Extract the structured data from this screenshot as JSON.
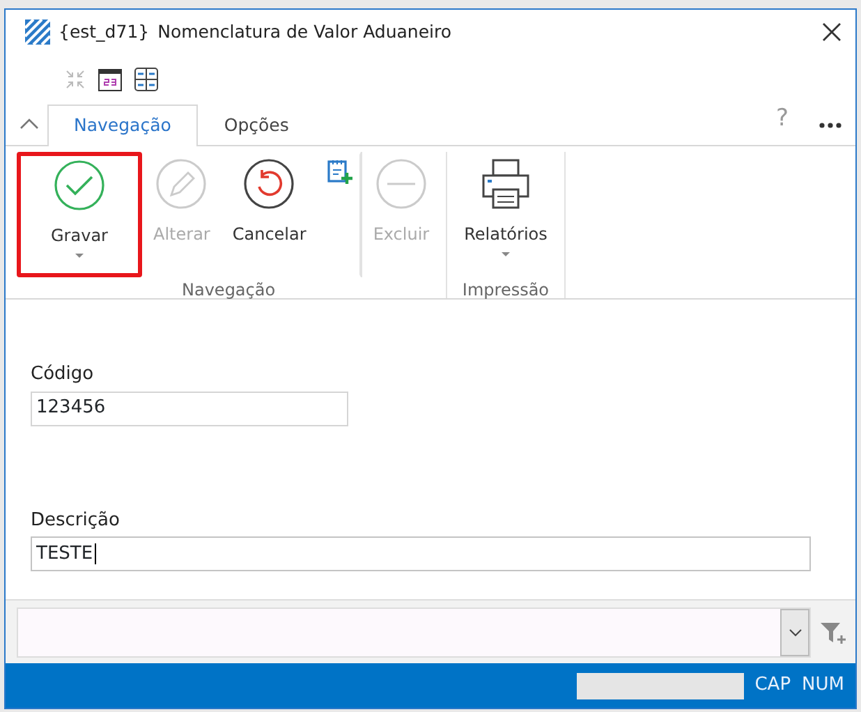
{
  "window": {
    "app_tag": "{est_d71}",
    "title": "Nomenclatura de Valor Aduaneiro"
  },
  "tabs": [
    {
      "label": "Navegação",
      "selected": true
    },
    {
      "label": "Opções",
      "selected": false
    }
  ],
  "help": "?",
  "ribbon": {
    "groups": [
      {
        "label": "Navegação",
        "buttons": [
          {
            "kind": "save",
            "label": "Gravar",
            "disabled": false,
            "dropdown": true,
            "highlighted": true
          },
          {
            "kind": "edit",
            "label": "Alterar",
            "disabled": true,
            "dropdown": false,
            "highlighted": false
          },
          {
            "kind": "cancel",
            "label": "Cancelar",
            "disabled": false,
            "dropdown": false,
            "highlighted": false
          },
          {
            "kind": "new",
            "disabled": false,
            "dropdown": false,
            "highlighted": false
          },
          {
            "kind": "delete",
            "label": "Excluir",
            "disabled": true,
            "dropdown": false,
            "highlighted": false
          }
        ]
      },
      {
        "label": "Impressão",
        "buttons": [
          {
            "kind": "print",
            "label": "Relatórios",
            "disabled": false,
            "dropdown": true,
            "highlighted": false
          }
        ]
      }
    ]
  },
  "fields": [
    {
      "label": "Código",
      "value": "123456",
      "focused": false
    },
    {
      "label": "Descrição",
      "value": "TESTE",
      "focused": true
    }
  ],
  "status_bar": {
    "indicators": [
      "CAP",
      "NUM"
    ]
  }
}
